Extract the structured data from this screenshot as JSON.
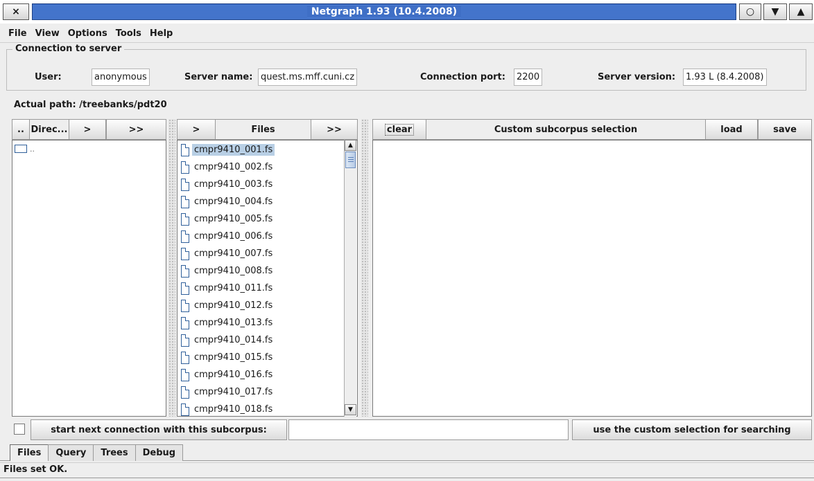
{
  "window": {
    "title": "Netgraph 1.93 (10.4.2008)",
    "close_glyph": "×",
    "iconify_glyph": "○",
    "maximize_glyph": "▼",
    "shade_glyph": "▲"
  },
  "menu": [
    "File",
    "View",
    "Options",
    "Tools",
    "Help"
  ],
  "connection": {
    "legend": "Connection to server",
    "user_label": "User:",
    "user_value": "anonymous",
    "server_label": "Server name:",
    "server_value": "quest.ms.mff.cuni.cz",
    "port_label": "Connection port:",
    "port_value": "2200",
    "version_label": "Server version:",
    "version_value": "1.93 L (8.4.2008)"
  },
  "path": "Actual path: /treebanks/pdt20",
  "dirs": {
    "up_btn": "..",
    "header": "Direc...",
    "add_btn": ">",
    "add_all_btn": ">>",
    "items": [
      ".."
    ]
  },
  "files": {
    "add_btn": ">",
    "header": "Files",
    "add_all_btn": ">>",
    "selected_index": 0,
    "items": [
      "cmpr9410_001.fs",
      "cmpr9410_002.fs",
      "cmpr9410_003.fs",
      "cmpr9410_004.fs",
      "cmpr9410_005.fs",
      "cmpr9410_006.fs",
      "cmpr9410_007.fs",
      "cmpr9410_008.fs",
      "cmpr9410_011.fs",
      "cmpr9410_012.fs",
      "cmpr9410_013.fs",
      "cmpr9410_014.fs",
      "cmpr9410_015.fs",
      "cmpr9410_016.fs",
      "cmpr9410_017.fs",
      "cmpr9410_018.fs"
    ]
  },
  "custom": {
    "clear_btn": "clear",
    "header": "Custom subcorpus selection",
    "load_btn": "load",
    "save_btn": "save"
  },
  "bottom": {
    "start_btn": "start next connection with this subcorpus:",
    "subcorpus_value": "",
    "use_btn": "use the custom selection for searching",
    "checkbox_checked": false
  },
  "tabs": [
    "Files",
    "Query",
    "Trees",
    "Debug"
  ],
  "active_tab": "Files",
  "status": "Files set OK."
}
